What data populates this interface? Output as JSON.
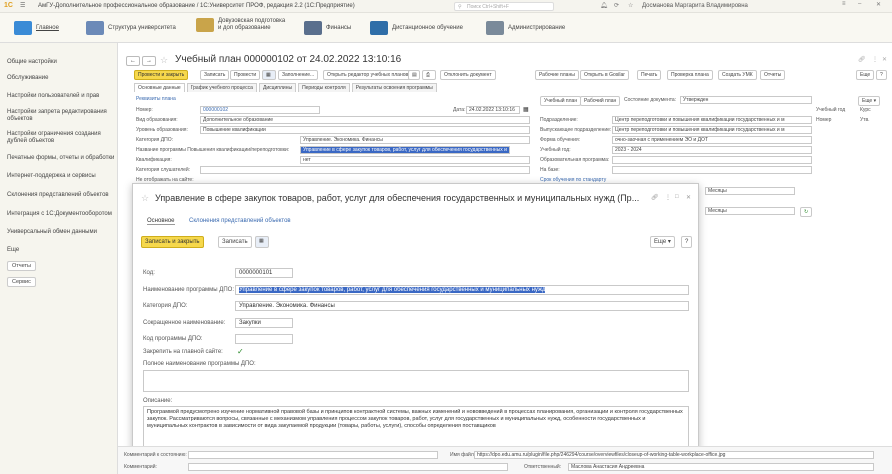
{
  "app": {
    "logo": "1С",
    "title": "АмГУ-Дополнительное профессиональное образование / 1С:Университет ПРОФ, редакция 2.2 (1С:Предприятие)",
    "search_placeholder": "Поиск Ctrl+Shift+F",
    "user": "Досманова Маргарита Владимировна"
  },
  "ribbon": {
    "sections": [
      {
        "label": "Главное",
        "color": "#3a8bd6"
      },
      {
        "label": "Структура университета",
        "color": "#6c8ab8"
      },
      {
        "label": "Довузовская подготовка и доп образование",
        "color": "#c9a44a"
      },
      {
        "label": "Финансы",
        "color": "#5a6f8d"
      },
      {
        "label": "Дистанционное обучение",
        "color": "#2f6ea8"
      },
      {
        "label": "Администрирование",
        "color": "#7a8a9a"
      }
    ]
  },
  "sidebar": {
    "items": [
      "Общие настройки",
      "Обслуживание",
      "Настройки пользователей и прав",
      "Настройки запрета редактирования объектов",
      "Настройки ограничения создания дублей объектов",
      "Печатные формы, отчеты и обработки",
      "Интернет-поддержка и сервисы",
      "Склонения представлений объектов",
      "Интеграция с 1С:Документооборотом",
      "Универсальный обмен данными",
      "Еще"
    ],
    "buttons": [
      "Отчеты",
      "Сервис"
    ]
  },
  "document": {
    "title": "Учебный план 000000102 от 24.02.2022 13:10:16",
    "toolbar": [
      "Провести и закрыть",
      "Записать",
      "Провести",
      "Заполнение...",
      "Открыть редактор учебных планов",
      "Отклонить документ",
      "Рабочие планы",
      "Открыть в Gosilar",
      "Печать",
      "Проверка плана",
      "Создать УМК",
      "Отчеты",
      "Еще"
    ],
    "tabs": [
      "Основные данные",
      "График учебного процесса",
      "Дисциплины",
      "Периоды контроля",
      "Результаты освоения программы"
    ],
    "group": "Реквизиты плана",
    "fields": {
      "number_label": "Номер:",
      "number": "000000102",
      "date_label": "Дата:",
      "date": "24.02.2022 13:10:16",
      "edu_type_label": "Вид образования:",
      "edu_type": "Дополнительное образование",
      "level_label": "Уровень образования:",
      "level": "Повышение квалификации",
      "dpo_cat_label": "Категория ДПО:",
      "dpo_cat": "Управление. Экономика. Финансы",
      "program_label": "Название программы Повышения квалификации/переподготовки:",
      "program": "Управление в сфере закупок товаров, работ, услуг для обеспечения государственных и",
      "qual_label": "Квалификация:",
      "qual": "нет",
      "listener_label": "Категория слушателей:",
      "no_site_label": "Не отображать на сайте:",
      "podr_label": "Подразделение:",
      "podr": "Центр переподготовки и повышения квалификации государственных и м",
      "vyp_label": "Выпускающее подразделение:",
      "vyp": "Центр переподготовки и повышения квалификации государственных и м",
      "form_label": "Форма обучения:",
      "form": "очно-заочная с применением ЭО и ДОТ",
      "year_label": "Учебный год:",
      "year": "2023 - 2024",
      "edu_prog_label": "Образовательная программа:",
      "base_label": "На базе:",
      "state_label": "Состояние документа:",
      "state": "Утвержден",
      "buttons": [
        "Учебный план",
        "Рабочий план"
      ]
    },
    "right_table": {
      "cols": [
        "Учебный год",
        "Курс"
      ],
      "row": [
        "Номер",
        "Утв."
      ]
    },
    "extra": {
      "months1": "Месяцы",
      "months2": "Месяцы",
      "sroki": "Срок обучения по стандарту"
    }
  },
  "modal": {
    "title": "Управление в сфере закупок товаров, работ, услуг для обеспечения государственных и муниципальных нужд (Пр...",
    "tabs": [
      "Основное",
      "Склонения представлений объектов"
    ],
    "save_close": "Записать и закрыть",
    "save": "Записать",
    "more": "Еще",
    "help": "?",
    "code_label": "Код:",
    "code": "0000000101",
    "name_label": "Наименование программы ДПО:",
    "name": "Управление в сфере закупок товаров, работ, услуг для обеспечения государственных и муниципальных нужд",
    "cat_label": "Категория ДПО:",
    "cat": "Управление. Экономика. Финансы",
    "short_label": "Сокращенное наименование:",
    "short": "Закупки",
    "code_prog_label": "Код программы ДПО:",
    "pin_label": "Закрепить на главной сайте:",
    "full_label": "Полное наименование программы ДПО:",
    "desc_label": "Описание:",
    "desc": "Программой предусмотрено изучение нормативной правовой базы и принципов контрактной системы, важных изменений и нововведений в процессах планирования, организации и контроля государственных закупок. Рассматриваются вопросы, связанные с механизмом управления процессом закупок товаров, работ, услуг для государственных и муниципальных нужд, особенности государственных и муниципальных контрактов в зависимости от вида закупаемой продукции (товары, работы, услуги), способы определения поставщиков"
  },
  "bottom": {
    "comment_label": "Комментарий к состоянию:",
    "comment2_label": "Комментарий:",
    "file_label": "Имя файла:",
    "file": "https://dpo.edu.amu.ru/plugin/file.php/246294/course/overviewfiles/closeup-of-working-table-workplace-office.jpg",
    "resp_label": "Ответственный:",
    "resp": "Маслова Анастасия Андреевна"
  }
}
